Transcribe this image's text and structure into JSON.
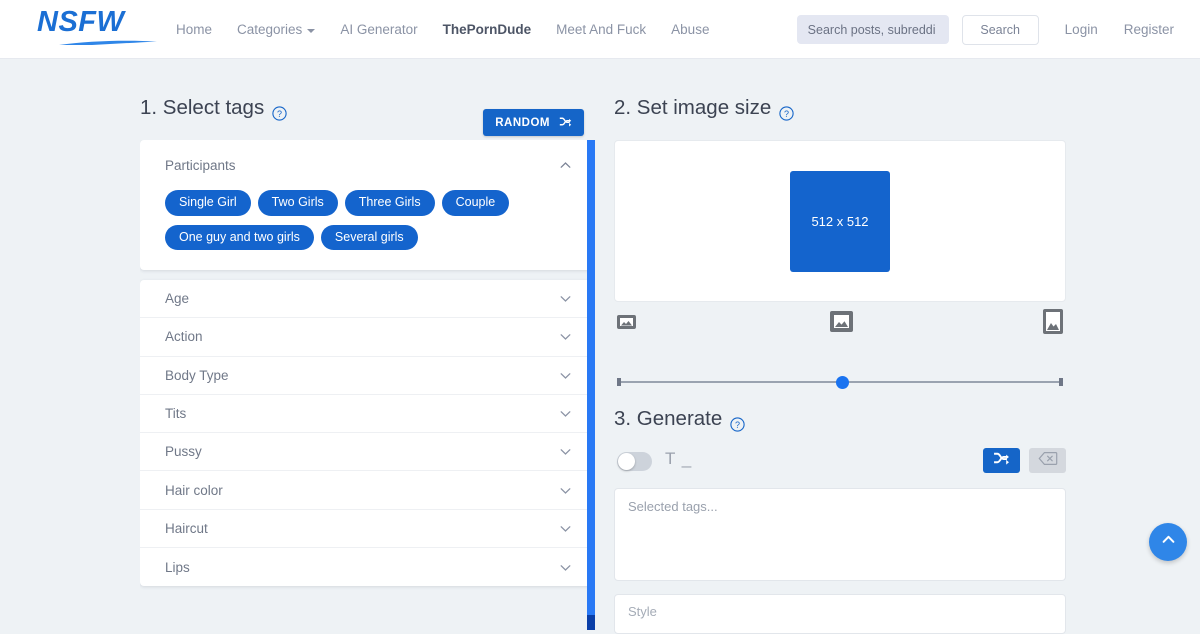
{
  "brand": {
    "logo_text": "NSFW",
    "accent": "#1565c8",
    "page_bg": "#eef2f5"
  },
  "header": {
    "nav": [
      {
        "label": "Home",
        "active": false,
        "has_caret": false
      },
      {
        "label": "Categories",
        "active": false,
        "has_caret": true
      },
      {
        "label": "AI Generator",
        "active": false,
        "has_caret": false
      },
      {
        "label": "ThePornDude",
        "active": true,
        "has_caret": false
      },
      {
        "label": "Meet And Fuck",
        "active": false,
        "has_caret": false
      },
      {
        "label": "Abuse",
        "active": false,
        "has_caret": false
      }
    ],
    "search": {
      "placeholder": "Search posts, subreddi",
      "value": ""
    },
    "search_button": "Search",
    "login": "Login",
    "register": "Register"
  },
  "step1": {
    "title": "1. Select tags",
    "help": "?",
    "random_button": "RANDOM",
    "random_icon": "shuffle-icon",
    "group": {
      "title": "Participants",
      "expanded": true,
      "chevron": "chevron-up-icon",
      "tags": [
        "Single Girl",
        "Two Girls",
        "Three Girls",
        "Couple",
        "One guy and two girls",
        "Several girls"
      ]
    },
    "collapsed_groups": [
      "Age",
      "Action",
      "Body Type",
      "Tits",
      "Pussy",
      "Hair color",
      "Haircut",
      "Lips"
    ]
  },
  "step2": {
    "title": "2. Set image size",
    "help": "?",
    "preview_label": "512 x 512",
    "size_icons": [
      "image-small-icon",
      "image-medium-icon",
      "image-large-portrait-icon"
    ],
    "slider_value": 50
  },
  "step3": {
    "title": "3. Generate",
    "help": "?",
    "toggle_on": false,
    "toggle_icon": "text-cursor-icon",
    "toggle_icon_label": "T _",
    "shuffle_button_icon": "shuffle-icon",
    "clear_button_icon": "backspace-delete-icon",
    "clear_button_disabled": true,
    "tags_placeholder": "Selected tags...",
    "tags_value": "",
    "style_placeholder": "Style"
  },
  "fab": {
    "icon": "chevron-up-icon",
    "label": "Scroll to top"
  }
}
